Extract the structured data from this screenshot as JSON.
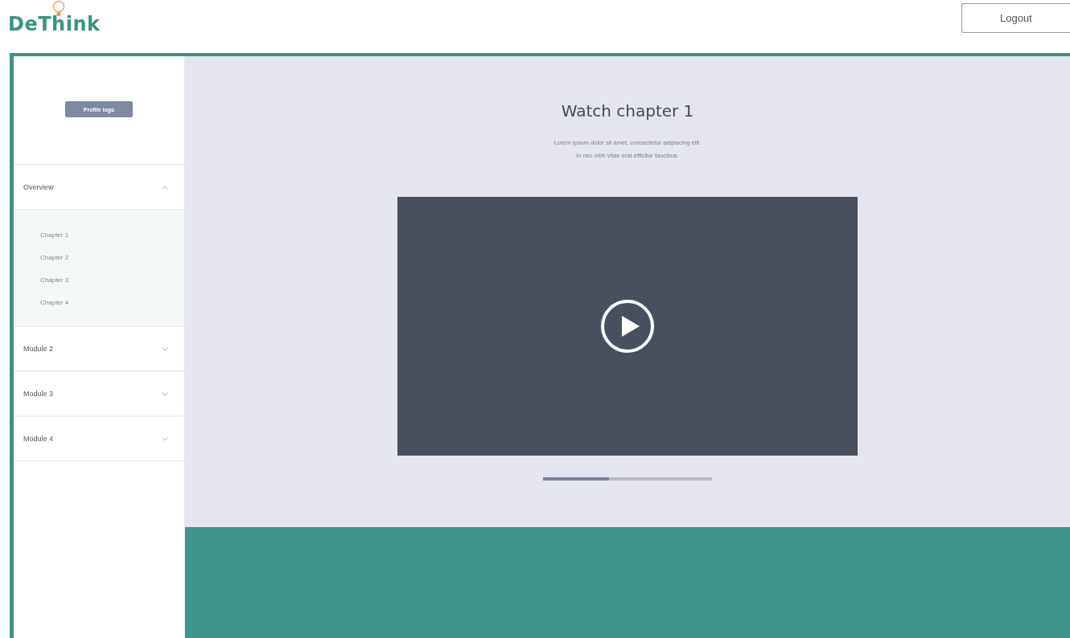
{
  "header": {
    "logo": "DeThink",
    "logout_button": "Logout"
  },
  "sidebar": {
    "profile_button": "Profile logo",
    "modules": [
      {
        "title": "Overview",
        "expanded": true,
        "chapters": [
          "Chapter 1",
          "Chapter 2",
          "Chapter 3",
          "Chapter 4"
        ]
      },
      {
        "title": "Module 2",
        "expanded": false
      },
      {
        "title": "Module 3",
        "expanded": false
      },
      {
        "title": "Module 4",
        "expanded": false
      }
    ]
  },
  "main": {
    "title": "Watch chapter 1",
    "description_lines": [
      "Lorem ipsum dolor sit amet, consectetur adipiscing elit.",
      "In nec nibh vitae erat efficitur faucibus."
    ],
    "progress": {
      "level": 0.39
    }
  }
}
